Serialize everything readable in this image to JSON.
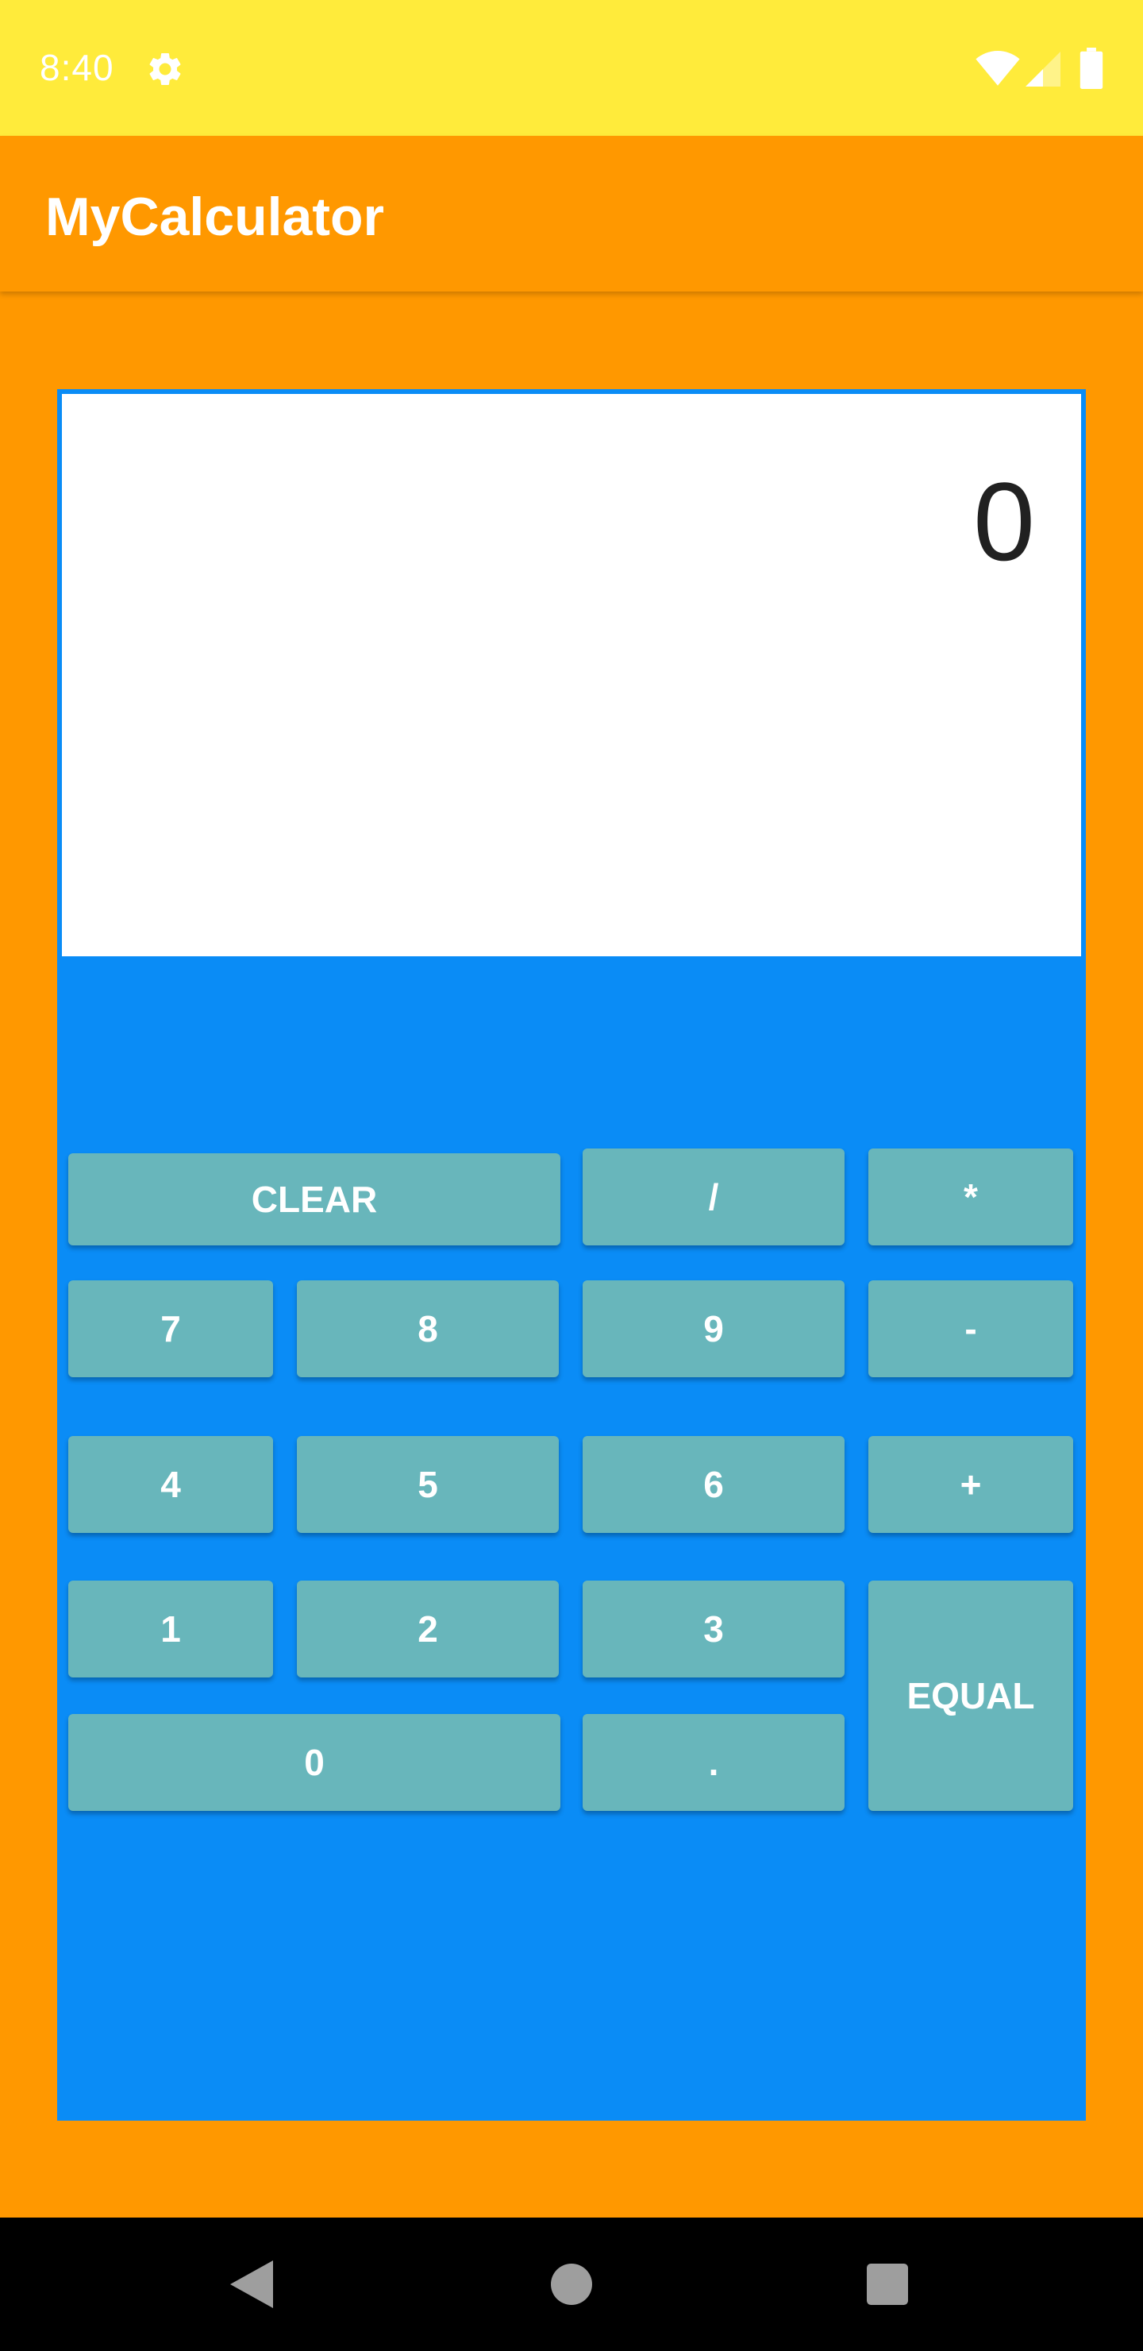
{
  "status_bar": {
    "time": "8:40",
    "icons": [
      "gear-icon",
      "wifi-icon",
      "signal-icon",
      "battery-icon"
    ]
  },
  "app_bar": {
    "title": "MyCalculator"
  },
  "display": {
    "value": "0"
  },
  "keypad": {
    "clear": "CLEAR",
    "divide": "/",
    "multiply": "*",
    "seven": "7",
    "eight": "8",
    "nine": "9",
    "minus": "-",
    "four": "4",
    "five": "5",
    "six": "6",
    "plus": "+",
    "one": "1",
    "two": "2",
    "three": "3",
    "equal": "EQUAL",
    "zero": "0",
    "dot": "."
  },
  "nav_bar": {
    "icons": [
      "back-icon",
      "home-icon",
      "recents-icon"
    ]
  },
  "colors": {
    "status_bar": "#FFEB3B",
    "primary": "#FF9800",
    "panel": "#0A8CF6",
    "button": "#68B6BB",
    "display_bg": "#FFFFFF"
  }
}
